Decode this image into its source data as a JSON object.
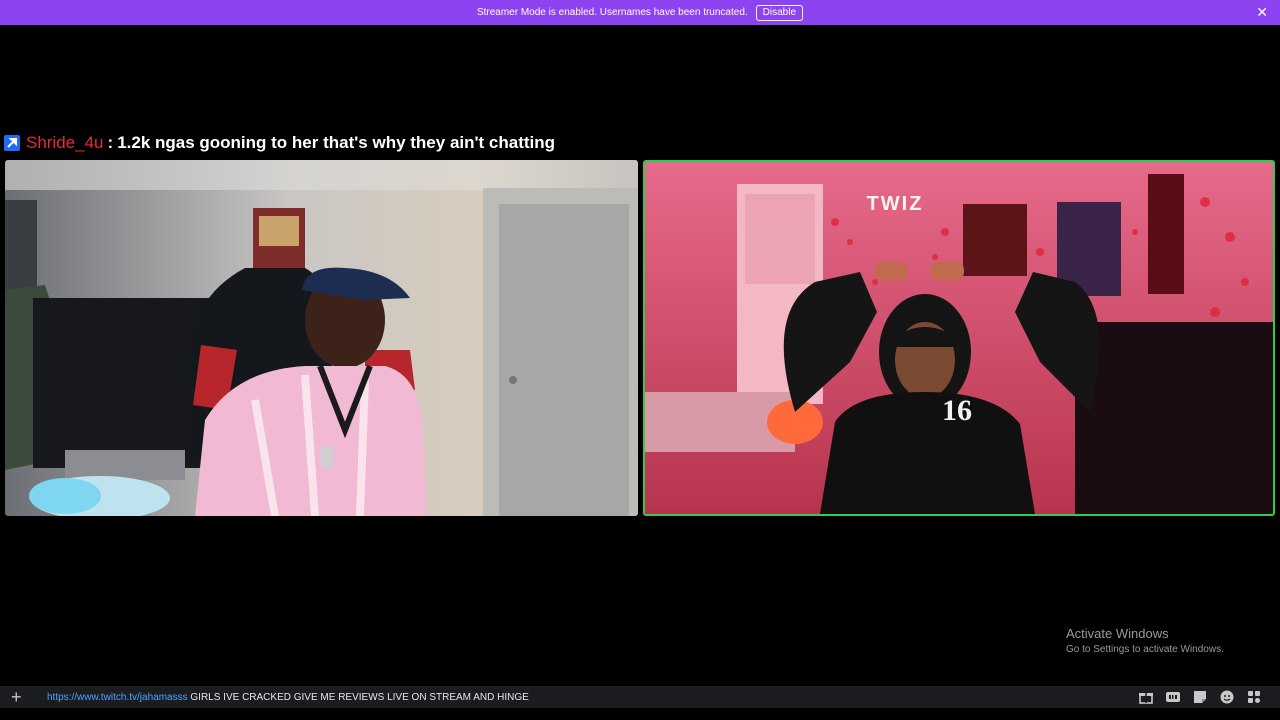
{
  "banner": {
    "message": "Streamer Mode is enabled. Usernames have been truncated.",
    "disable_label": "Disable",
    "close_glyph": "✕",
    "color": "#8d43f0"
  },
  "overlay": {
    "badge_icon": "pick-icon",
    "username": "Shride_4u",
    "separator": ":",
    "message": "1.2k ngas gooning to her that's why they ain't chatting",
    "username_color": "#e52b34"
  },
  "videos": {
    "left": {
      "description_icon": "camera-feed-streamer-1"
    },
    "right": {
      "sign_text": "TWIZ",
      "jersey_number": "16",
      "active_border_color": "#2fcc51"
    }
  },
  "input": {
    "plus_glyph": "+",
    "link": "https://www.twitch.tv/jahamasss",
    "text": " GIRLS IVE CRACKED GIVE ME REVIEWS LIVE ON STREAM AND HINGE"
  },
  "toolbar": {
    "icons": [
      "gift-icon",
      "gif-icon",
      "sticker-icon",
      "emoji-icon",
      "apps-icon"
    ]
  },
  "watermark": {
    "title": "Activate Windows",
    "subtitle": "Go to Settings to activate Windows."
  }
}
